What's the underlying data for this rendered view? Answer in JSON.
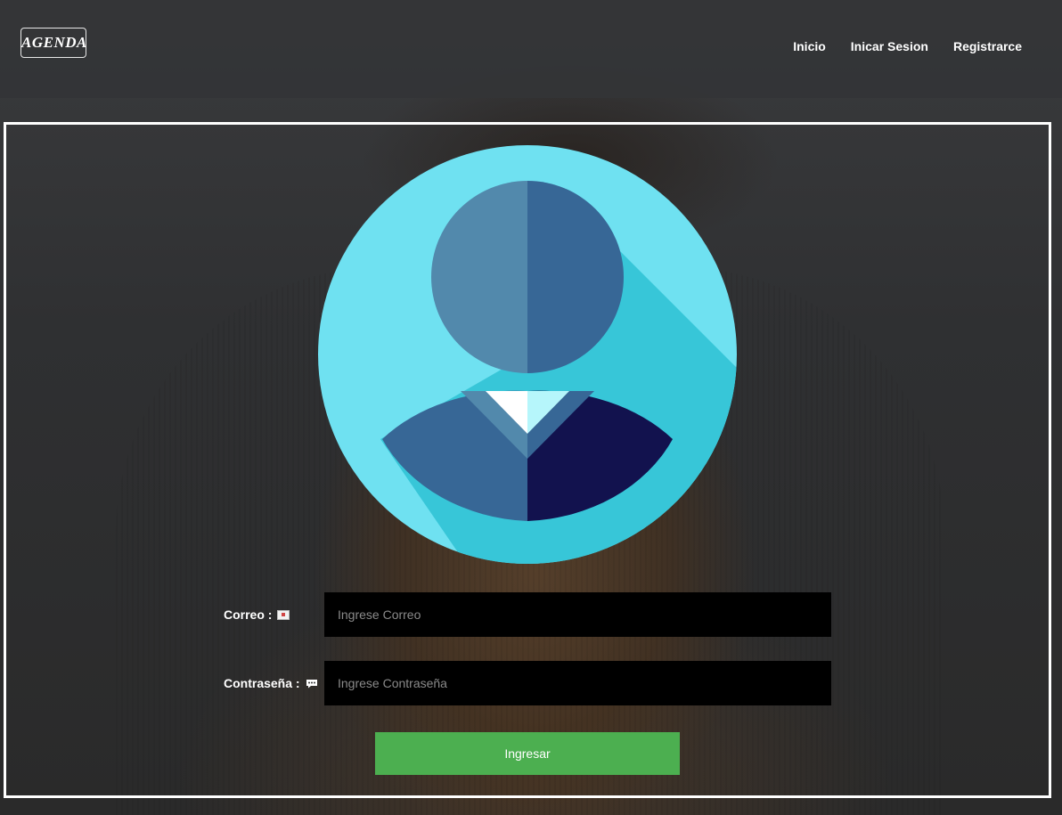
{
  "navbar": {
    "logo_text": "AGENDA",
    "links": [
      "Inicio",
      "Inicar Sesion",
      "Registrarce"
    ]
  },
  "form": {
    "email": {
      "label": "Correo :",
      "icon": "envelope-icon",
      "placeholder": "Ingrese Correo",
      "value": ""
    },
    "password": {
      "label": "Contraseña :",
      "icon": "speech-bubble-icon",
      "placeholder": "Ingrese Contraseña",
      "value": ""
    },
    "submit_label": "Ingresar"
  },
  "colors": {
    "navbar_bg": "#343537",
    "avatar_circle": "#6fe1f1",
    "avatar_shadow": "#37c6d8",
    "submit_bg": "#4caf50",
    "input_bg": "#000000"
  }
}
